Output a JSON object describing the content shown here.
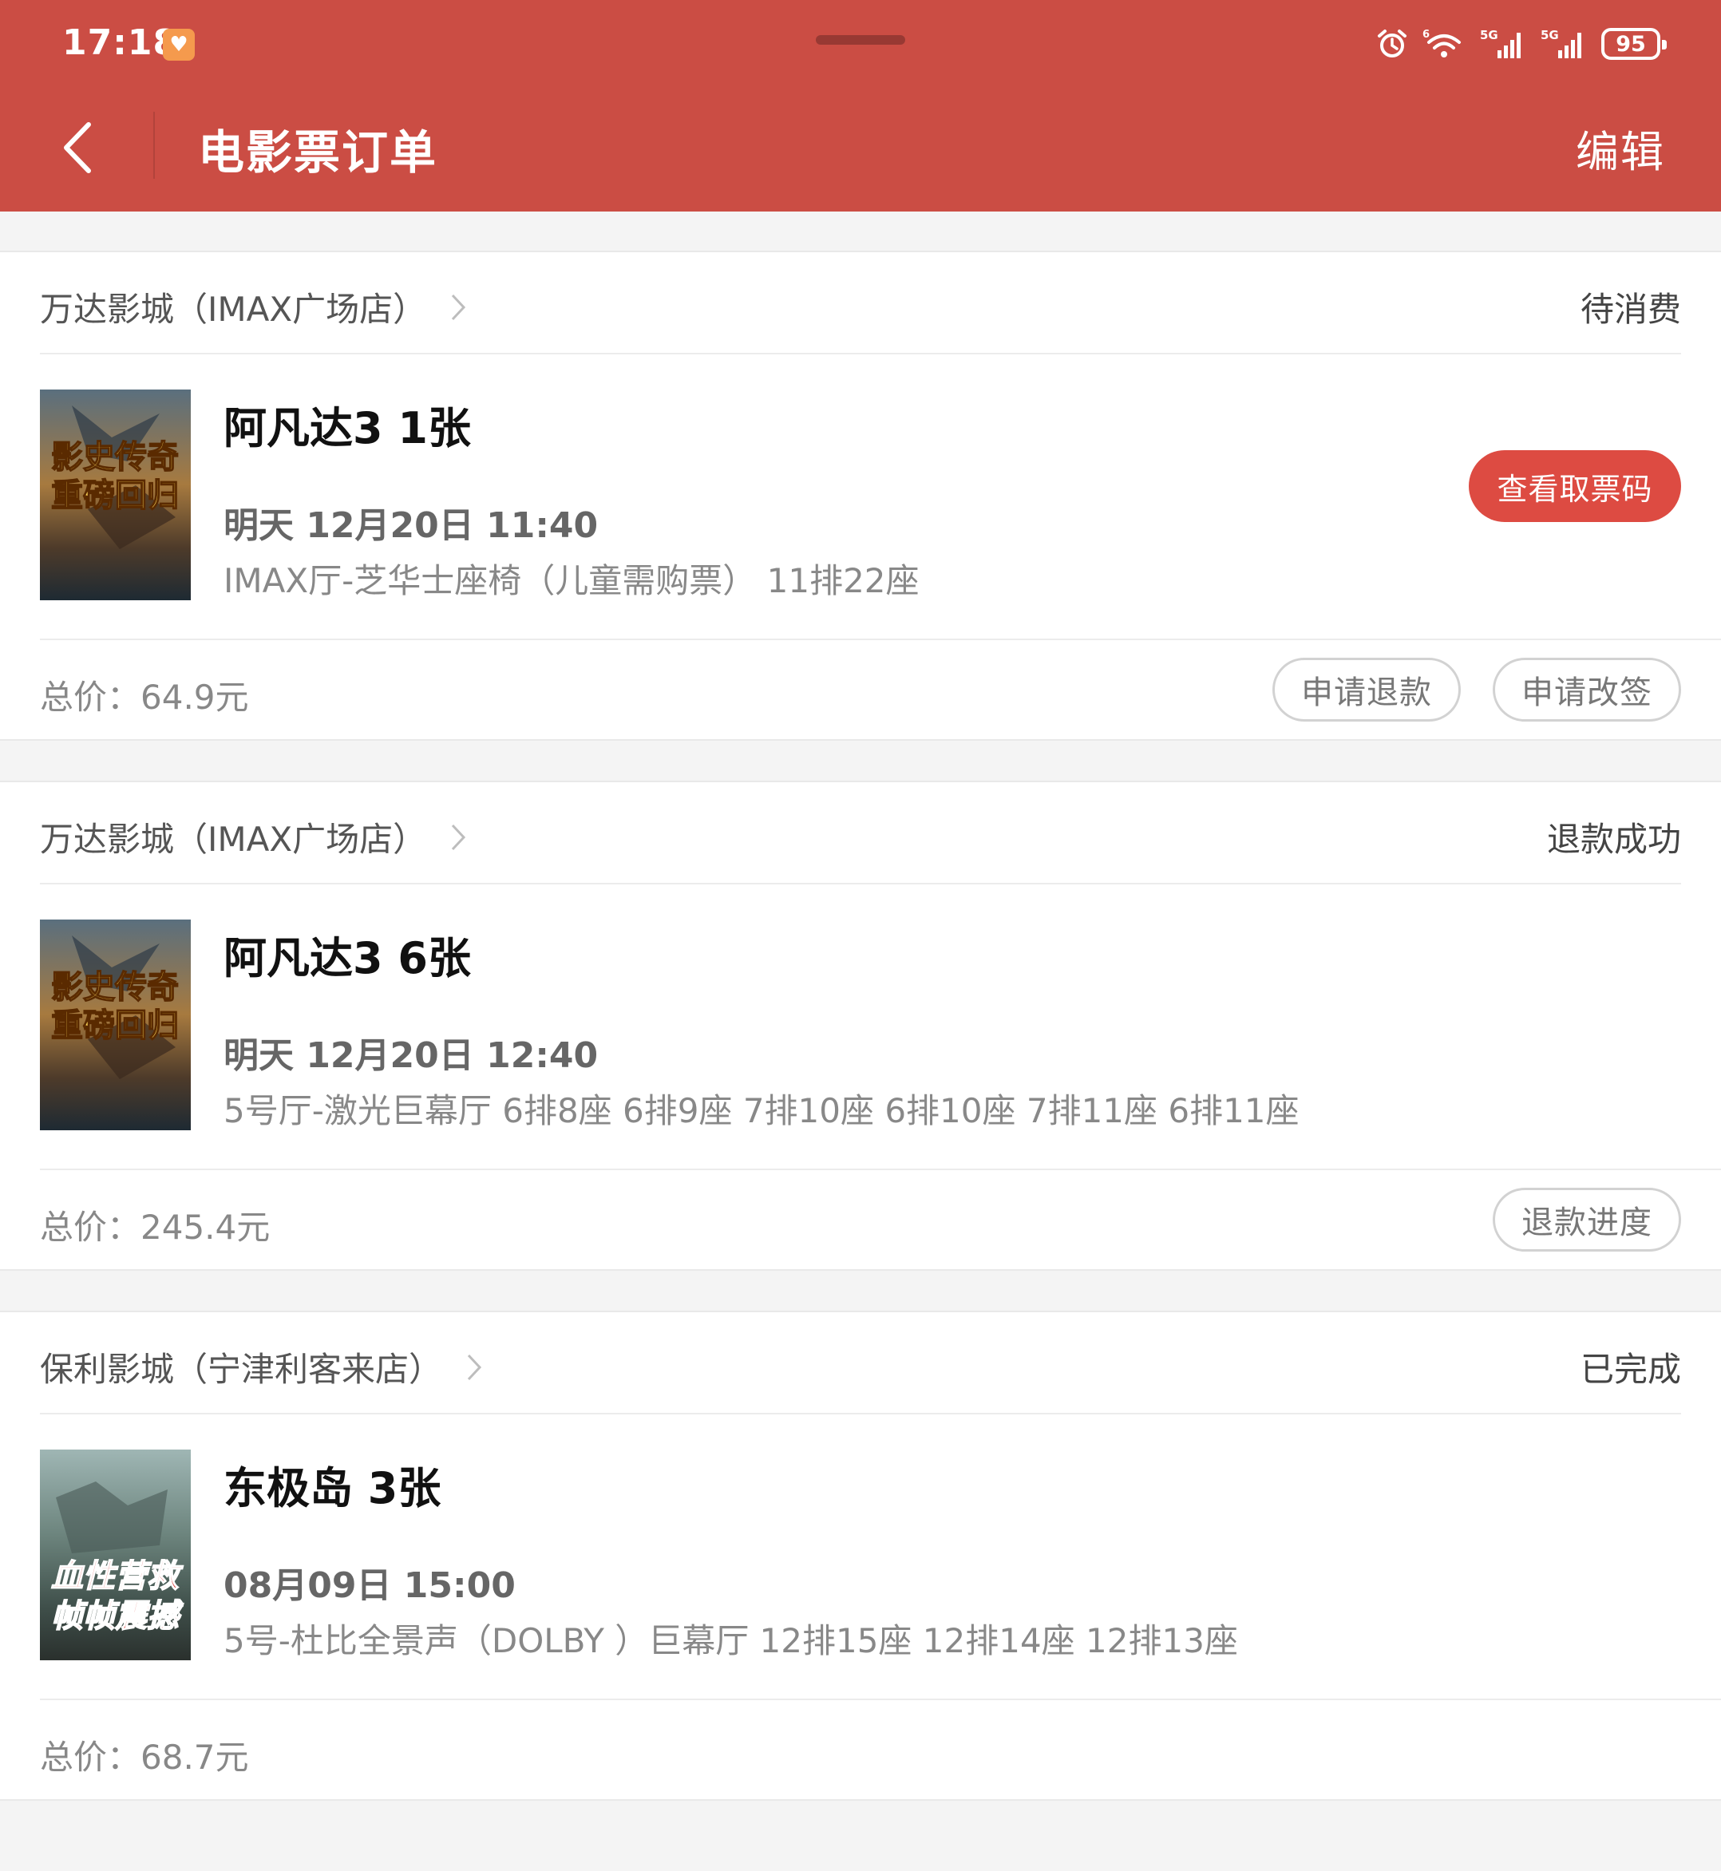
{
  "status_bar": {
    "time": "17:18",
    "battery": "95",
    "network_1": "5G",
    "network_2": "5G",
    "wifi_label": "6"
  },
  "header": {
    "title": "电影票订单",
    "edit_label": "编辑",
    "back_icon": "chevron-left-icon"
  },
  "colors": {
    "header_bg": "#cb4d44",
    "primary_button": "#dd4b42",
    "page_bg": "#f4f4f4"
  },
  "orders": [
    {
      "cinema": "万达影城（IMAX广场店）",
      "status": "待消费",
      "title": "阿凡达3 1张",
      "showtime": "明天 12月20日 11:40",
      "seats": "IMAX厅-芝华士座椅（儿童需购票） 11排22座",
      "total": "总价：64.9元",
      "primary_action": "查看取票码",
      "actions": [
        "申请退款",
        "申请改签"
      ],
      "poster_text": [
        "影史传奇",
        "重磅回归"
      ]
    },
    {
      "cinema": "万达影城（IMAX广场店）",
      "status": "退款成功",
      "title": "阿凡达3 6张",
      "showtime": "明天 12月20日 12:40",
      "seats": "5号厅-激光巨幕厅 6排8座 6排9座 7排10座 6排10座 7排11座 6排11座",
      "total": "总价：245.4元",
      "actions": [
        "退款进度"
      ],
      "poster_text": [
        "影史传奇",
        "重磅回归"
      ]
    },
    {
      "cinema": "保利影城（宁津利客来店）",
      "status": "已完成",
      "title": "东极岛 3张",
      "showtime": "08月09日 15:00",
      "seats": "5号-杜比全景声（DOLBY ）巨幕厅 12排15座 12排14座 12排13座",
      "total": "总价：68.7元",
      "actions": [],
      "poster_text": [
        "血性营救",
        "帧帧震撼"
      ]
    }
  ]
}
